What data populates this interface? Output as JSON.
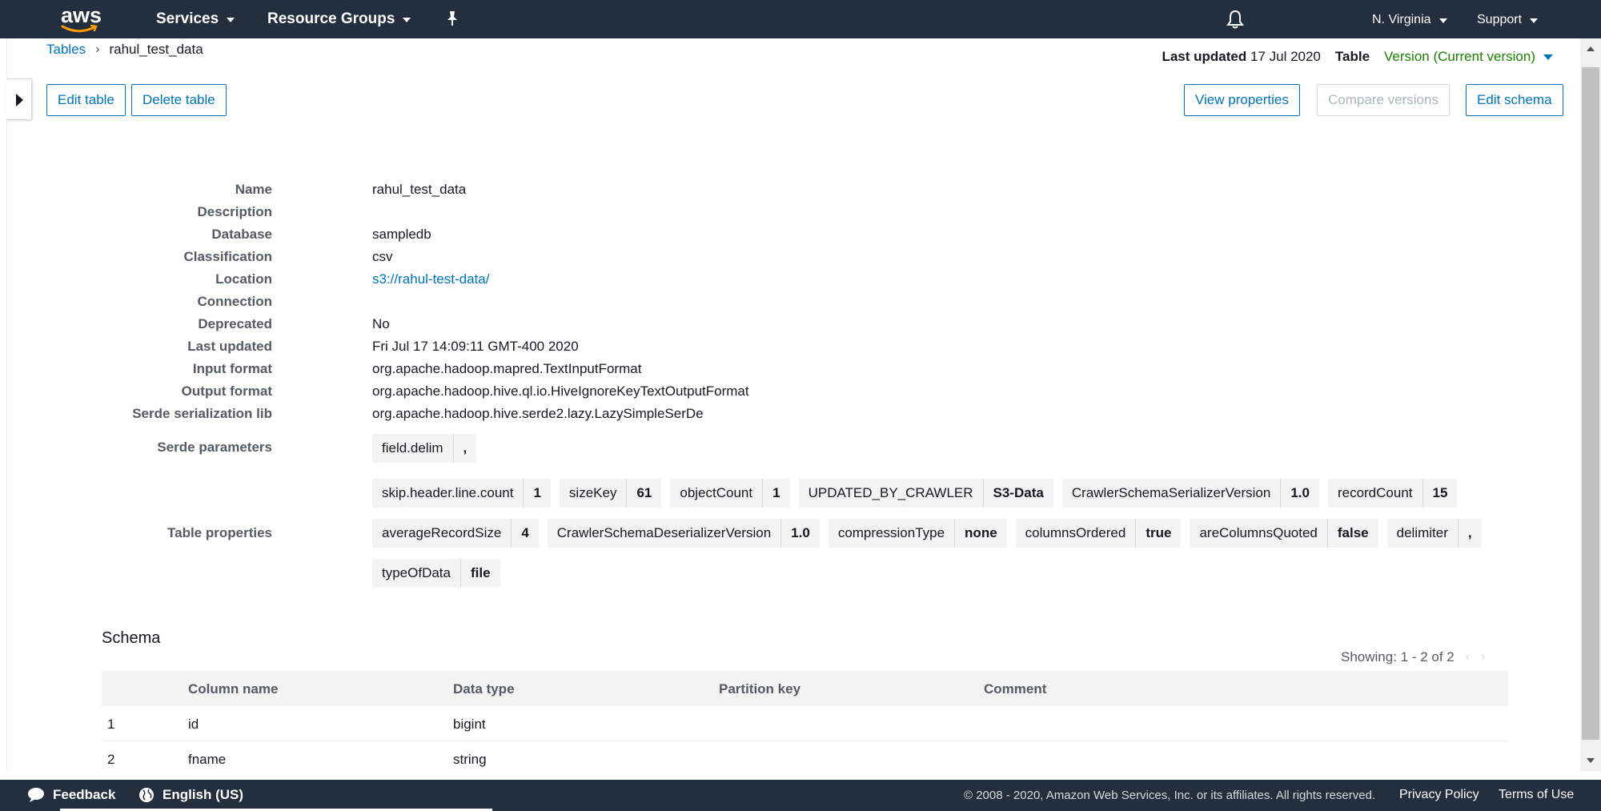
{
  "topnav": {
    "logo_text": "aws",
    "services": "Services",
    "resource_groups": "Resource Groups",
    "region": "N. Virginia",
    "support": "Support"
  },
  "breadcrumb": {
    "parent": "Tables",
    "current": "rahul_test_data"
  },
  "meta": {
    "last_updated_label": "Last updated",
    "last_updated_value": "17 Jul 2020",
    "table_label": "Table",
    "version": "Version (Current version)"
  },
  "actions": {
    "edit_table": "Edit table",
    "delete_table": "Delete table",
    "view_properties": "View properties",
    "compare_versions": "Compare versions",
    "edit_schema": "Edit schema"
  },
  "details": {
    "name_label": "Name",
    "name": "rahul_test_data",
    "description_label": "Description",
    "description": "",
    "database_label": "Database",
    "database": "sampledb",
    "classification_label": "Classification",
    "classification": "csv",
    "location_label": "Location",
    "location": "s3://rahul-test-data/",
    "connection_label": "Connection",
    "connection": "",
    "deprecated_label": "Deprecated",
    "deprecated": "No",
    "last_updated_label": "Last updated",
    "last_updated": "Fri Jul 17 14:09:11 GMT-400 2020",
    "input_format_label": "Input format",
    "input_format": "org.apache.hadoop.mapred.TextInputFormat",
    "output_format_label": "Output format",
    "output_format": "org.apache.hadoop.hive.ql.io.HiveIgnoreKeyTextOutputFormat",
    "serde_lib_label": "Serde serialization lib",
    "serde_lib": "org.apache.hadoop.hive.serde2.lazy.LazySimpleSerDe",
    "serde_params_label": "Serde parameters",
    "serde_params": [
      {
        "key": "field.delim",
        "value": ","
      }
    ],
    "table_properties_label": "Table properties",
    "table_properties": [
      [
        {
          "key": "skip.header.line.count",
          "value": "1"
        },
        {
          "key": "sizeKey",
          "value": "61"
        },
        {
          "key": "objectCount",
          "value": "1"
        },
        {
          "key": "UPDATED_BY_CRAWLER",
          "value": "S3-Data"
        },
        {
          "key": "CrawlerSchemaSerializerVersion",
          "value": "1.0"
        },
        {
          "key": "recordCount",
          "value": "15"
        }
      ],
      [
        {
          "key": "averageRecordSize",
          "value": "4"
        },
        {
          "key": "CrawlerSchemaDeserializerVersion",
          "value": "1.0"
        },
        {
          "key": "compressionType",
          "value": "none"
        },
        {
          "key": "columnsOrdered",
          "value": "true"
        },
        {
          "key": "areColumnsQuoted",
          "value": "false"
        },
        {
          "key": "delimiter",
          "value": ","
        }
      ],
      [
        {
          "key": "typeOfData",
          "value": "file"
        }
      ]
    ]
  },
  "schema": {
    "title": "Schema",
    "showing": "Showing: 1 - 2 of 2",
    "columns": [
      "Column name",
      "Data type",
      "Partition key",
      "Comment"
    ],
    "rows": [
      {
        "index": "1",
        "name": "id",
        "type": "bigint",
        "partition": "",
        "comment": ""
      },
      {
        "index": "2",
        "name": "fname",
        "type": "string",
        "partition": "",
        "comment": ""
      }
    ]
  },
  "footer": {
    "feedback": "Feedback",
    "language": "English (US)",
    "copyright": "© 2008 - 2020, Amazon Web Services, Inc. or its affiliates. All rights reserved.",
    "privacy": "Privacy Policy",
    "terms": "Terms of Use"
  }
}
